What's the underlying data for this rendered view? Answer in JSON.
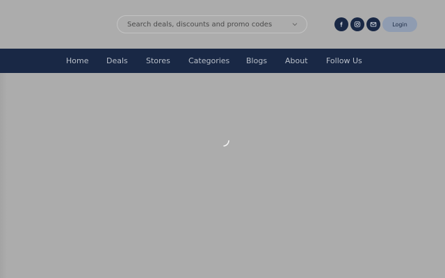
{
  "search": {
    "placeholder": "Search deals, discounts and promo codes",
    "dropdown_icon": "chevron-down-icon"
  },
  "social": [
    {
      "name": "facebook",
      "icon": "facebook-icon"
    },
    {
      "name": "instagram",
      "icon": "instagram-icon"
    },
    {
      "name": "email",
      "icon": "mail-icon"
    }
  ],
  "header": {
    "login_label": "Login"
  },
  "nav": {
    "items": [
      {
        "label": "Home"
      },
      {
        "label": "Deals"
      },
      {
        "label": "Stores"
      },
      {
        "label": "Categories"
      },
      {
        "label": "Blogs"
      },
      {
        "label": "About"
      },
      {
        "label": "Follow Us"
      }
    ]
  },
  "loading": {
    "icon": "spinner-icon"
  },
  "colors": {
    "navbar_bg": "#192845",
    "page_overlay": "#acacac",
    "login_bg": "#8f9cb1",
    "nav_text": "#b9bfc9"
  }
}
